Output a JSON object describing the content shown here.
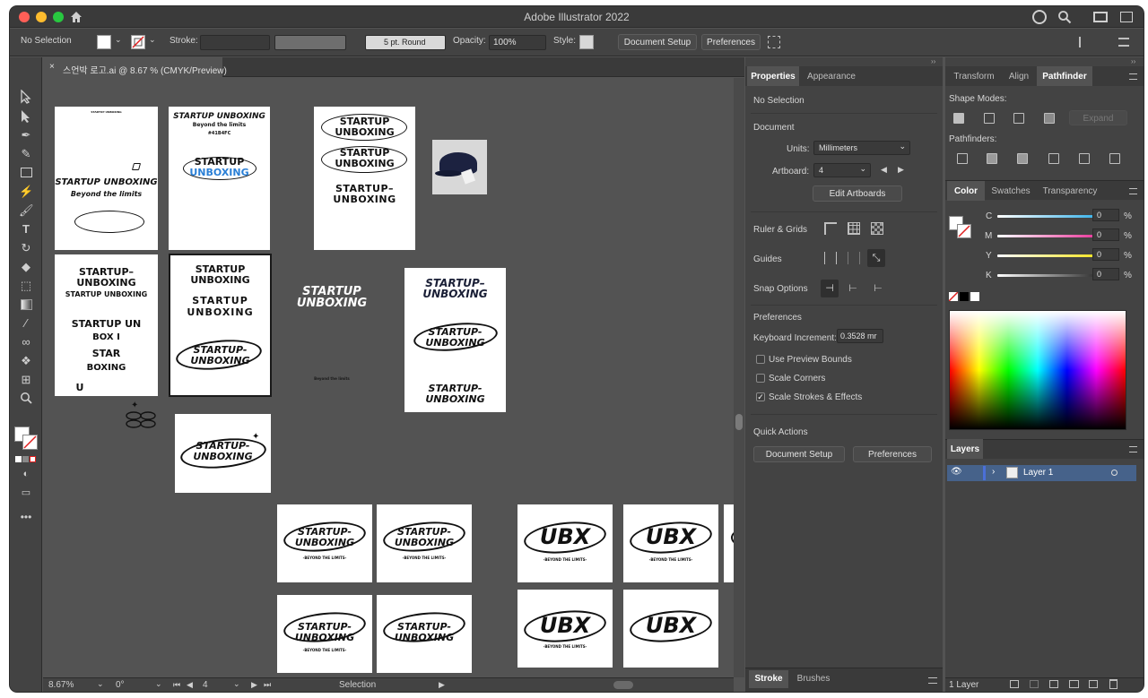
{
  "window": {
    "title": "Adobe Illustrator 2022"
  },
  "control_bar": {
    "selection": "No Selection",
    "stroke_label": "Stroke:",
    "brush": "5 pt. Round",
    "opacity_label": "Opacity:",
    "opacity_value": "100%",
    "style_label": "Style:",
    "document_setup": "Document Setup",
    "preferences": "Preferences"
  },
  "document_tab": {
    "title": "스언박 로고.ai @ 8.67 % (CMYK/Preview)"
  },
  "artboard_content": {
    "small_header": "STARTUP UNBOXING",
    "startup_unboxing": "STARTUP UNBOXING",
    "beyond_limits_italic": "Beyond the limits",
    "startup_unboxing_caps": "STARTUP UNBOXING",
    "startup_un": "STARTUP UN",
    "box": "BOX",
    "ing": "ING",
    "beyond_limits": "Beyond the limits",
    "color_code": "#41B4FC",
    "startup": "STARTUP",
    "unboxing": "UNBOXING",
    "startup_dash": "STARTUP-",
    "startup_dash_long": "STARTUP–",
    "unboxing_plain": "UNBOXING",
    "start": "START",
    "u_letter": "U",
    "n_letter": "N",
    "p_letter": "P",
    "box_i": "BOX I",
    "ng": "NG",
    "st_u": "STAR",
    "t_letter": "T",
    "boxing": "BOXING",
    "u_single": "U",
    "beyond_small": "Beyond the limits",
    "beyond_caption": "-BEYOND THE LIMITS-",
    "ubx": "UBX"
  },
  "status_bar": {
    "zoom": "8.67%",
    "rotation": "0°",
    "artboard_num": "4",
    "tool": "Selection"
  },
  "properties_panel": {
    "tabs": [
      "Properties",
      "Appearance"
    ],
    "no_selection": "No Selection",
    "document_heading": "Document",
    "units_label": "Units:",
    "units_value": "Millimeters",
    "artboard_label": "Artboard:",
    "artboard_value": "4",
    "edit_artboards": "Edit Artboards",
    "ruler_grids": "Ruler & Grids",
    "guides": "Guides",
    "snap_options": "Snap Options",
    "preferences_heading": "Preferences",
    "keyboard_increment_label": "Keyboard Increment:",
    "keyboard_increment_value": "0.3528 mr",
    "use_preview_bounds": "Use Preview Bounds",
    "scale_corners": "Scale Corners",
    "scale_strokes": "Scale Strokes & Effects",
    "quick_actions": "Quick Actions",
    "qa_document_setup": "Document Setup",
    "qa_preferences": "Preferences",
    "bottom_tabs": [
      "Stroke",
      "Brushes"
    ]
  },
  "right_panel": {
    "top_tabs": [
      "Transform",
      "Align",
      "Pathfinder"
    ],
    "shape_modes": "Shape Modes:",
    "expand": "Expand",
    "pathfinders": "Pathfinders:",
    "color_tabs": [
      "Color",
      "Swatches",
      "Transparency"
    ],
    "channels": [
      {
        "label": "C",
        "value": "0",
        "pct": "%",
        "color": "#1aa6e6"
      },
      {
        "label": "M",
        "value": "0",
        "pct": "%",
        "color": "#e6198c"
      },
      {
        "label": "Y",
        "value": "0",
        "pct": "%",
        "color": "#f2e000"
      },
      {
        "label": "K",
        "value": "0",
        "pct": "%",
        "color": "#111111"
      }
    ],
    "layers_tab": "Layers",
    "layer_name": "Layer 1",
    "layer_count": "1 Layer"
  }
}
